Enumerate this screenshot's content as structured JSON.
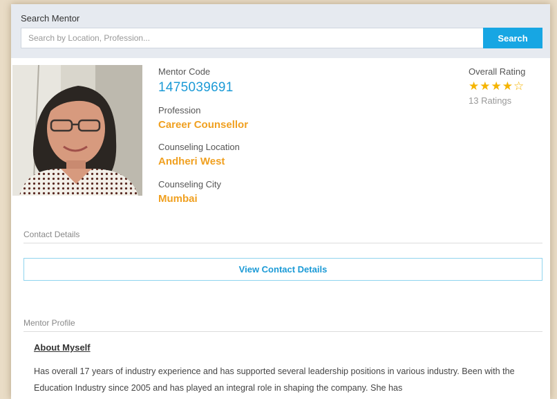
{
  "search": {
    "label": "Search Mentor",
    "placeholder": "Search by Location, Profession...",
    "value": "",
    "button_label": "Search"
  },
  "profile": {
    "photo_alt": "Mentor photo",
    "mentor_code_label": "Mentor Code",
    "mentor_code": "1475039691",
    "profession_label": "Profession",
    "profession": "Career Counsellor",
    "location_label": "Counseling Location",
    "location": "Andheri West",
    "city_label": "Counseling City",
    "city": "Mumbai"
  },
  "rating": {
    "label": "Overall Rating",
    "stars_filled": 4,
    "stars_total": 5,
    "stars_display": "★★★★☆",
    "count_text": "13 Ratings"
  },
  "contact": {
    "section_label": "Contact Details",
    "button_label": "View Contact Details"
  },
  "mentor_profile": {
    "section_label": "Mentor Profile",
    "about_title": "About Myself",
    "about_text": "Has overall 17 years of industry experience and has supported several leadership positions in various industry. Been with the Education Industry since 2005 and has played an integral role in shaping the company. She has"
  },
  "colors": {
    "accent_blue": "#17a6e3",
    "value_orange": "#f0a020",
    "star_gold": "#f5b400"
  }
}
